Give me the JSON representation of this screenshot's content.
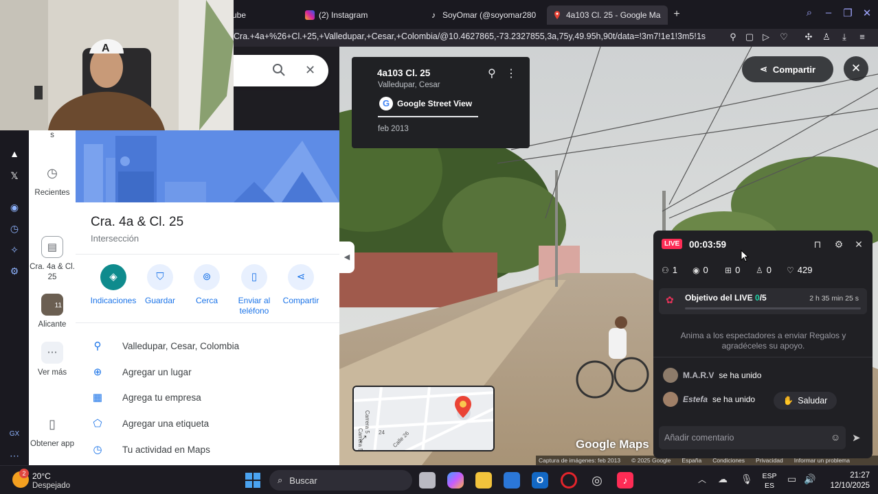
{
  "browser": {
    "tabs": [
      {
        "label": "ube",
        "favicon": "youtube-icon"
      },
      {
        "label": "(2) Instagram",
        "favicon": "instagram-icon"
      },
      {
        "label": "SoyOmar (@soyomar280",
        "favicon": "tiktok-icon"
      },
      {
        "label": "4a103 Cl. 25 - Google Ma",
        "favicon": "google-maps-icon",
        "active": true
      }
    ],
    "new_tab_label": "+",
    "url": "Cra.+4a+%26+Cl.+25,+Valledupar,+Cesar,+Colombia/@10.4627865,-73.2327855,3a,75y,49.95h,90t/data=!3m7!1e1!3m5!1s"
  },
  "maps": {
    "rail": {
      "partial_label": "s",
      "recents_label": "Recientes",
      "saved_place_label": "Cra. 4a & Cl. 25",
      "alicante_label": "Alicante",
      "alicante_badge": "11",
      "more_label": "Ver más",
      "get_app_label": "Obtener app"
    },
    "place": {
      "title": "Cra. 4a & Cl. 25",
      "subtitle": "Intersección"
    },
    "actions": [
      {
        "label": "Indicaciones",
        "icon": "directions-icon"
      },
      {
        "label": "Guardar",
        "icon": "bookmark-icon"
      },
      {
        "label": "Cerca",
        "icon": "nearby-icon"
      },
      {
        "label": "Enviar al teléfono",
        "icon": "send-to-phone-icon"
      },
      {
        "label": "Compartir",
        "icon": "share-icon"
      }
    ],
    "info_rows": [
      {
        "label": "Valledupar, Cesar, Colombia",
        "icon": "location-pin-icon"
      },
      {
        "label": "Agregar un lugar",
        "icon": "add-location-icon"
      },
      {
        "label": "Agrega tu empresa",
        "icon": "add-business-icon"
      },
      {
        "label": "Agregar una etiqueta",
        "icon": "label-icon"
      },
      {
        "label": "Tu actividad en Maps",
        "icon": "history-icon"
      }
    ]
  },
  "street_view": {
    "card_title": "4a103 Cl. 25",
    "card_subtitle": "Valledupar, Cesar",
    "provider": "Google Street View",
    "date": "feb 2013",
    "share_label": "Compartir",
    "logo_text": "Google Maps",
    "minimap_labels": [
      "Carrera 5",
      "Carrera 5b",
      "24",
      "Calle 26"
    ],
    "footer": [
      "Captura de imágenes: feb 2013",
      "© 2025 Google",
      "España",
      "Condiciones",
      "Privacidad",
      "Informar un problema"
    ]
  },
  "live": {
    "badge": "LIVE",
    "timer": "00:03:59",
    "stats": [
      {
        "icon": "viewers-icon",
        "value": "1"
      },
      {
        "icon": "eye-icon",
        "value": "0"
      },
      {
        "icon": "gift-icon",
        "value": "0"
      },
      {
        "icon": "follower-icon",
        "value": "0"
      },
      {
        "icon": "heart-icon",
        "value": "429"
      }
    ],
    "goal_label": "Objetivo del LIVE",
    "goal_current": "0",
    "goal_total": "/5",
    "goal_time": "2 h 35 min 25 s",
    "hint": "Anima a los espectadores a enviar Regalos y agradéceles su apoyo.",
    "chat": [
      {
        "name": "M.A.R.V",
        "text": "se ha unido"
      },
      {
        "name": "Estefa",
        "text": "se ha unido"
      }
    ],
    "greet_label": "Saludar",
    "comment_placeholder": "Añadir comentario"
  },
  "taskbar": {
    "weather_temp": "20°C",
    "weather_text": "Despejado",
    "weather_badge": "2",
    "search_label": "Buscar",
    "lang_top": "ESP",
    "lang_bottom": "ES",
    "time": "21:27",
    "date": "12/10/2025"
  },
  "colors": {
    "maps_blue": "#1a73e8",
    "directions_teal": "#0f8b8d",
    "live_red": "#fe2c55",
    "goal_green": "#20d5a8"
  }
}
